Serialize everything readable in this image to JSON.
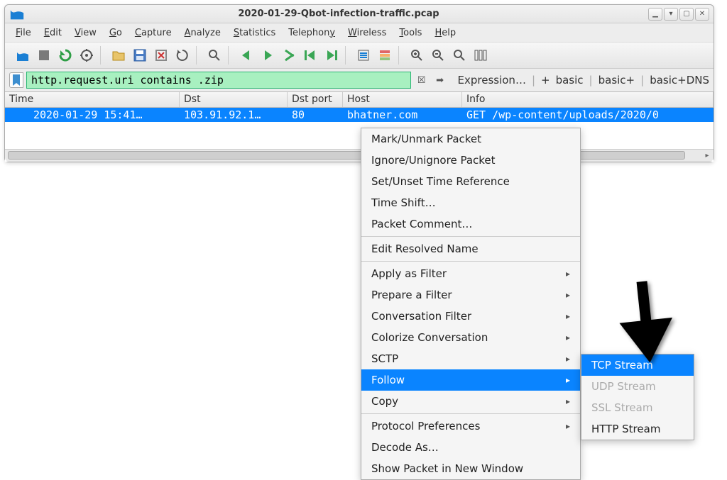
{
  "window": {
    "title": "2020-01-29-Qbot-infection-traffic.pcap"
  },
  "menubar": [
    "File",
    "Edit",
    "View",
    "Go",
    "Capture",
    "Analyze",
    "Statistics",
    "Telephony",
    "Wireless",
    "Tools",
    "Help"
  ],
  "filter": {
    "value": "http.request.uri contains .zip",
    "expression_label": "Expression…",
    "btn_plus": "+",
    "bookmarks": [
      "basic",
      "basic+",
      "basic+DNS"
    ]
  },
  "columns": {
    "time": "Time",
    "dst": "Dst",
    "dstport": "Dst port",
    "host": "Host",
    "info": "Info"
  },
  "rows": [
    {
      "time": "2020-01-29 15:41…",
      "dst": "103.91.92.1…",
      "dstport": "80",
      "host": "bhatner.com",
      "info": "GET /wp-content/uploads/2020/0"
    }
  ],
  "context_menu": {
    "items": [
      {
        "label": "Mark/Unmark Packet"
      },
      {
        "label": "Ignore/Unignore Packet"
      },
      {
        "label": "Set/Unset Time Reference"
      },
      {
        "label": "Time Shift…"
      },
      {
        "label": "Packet Comment…"
      },
      {
        "sep": true
      },
      {
        "label": "Edit Resolved Name"
      },
      {
        "sep": true
      },
      {
        "label": "Apply as Filter",
        "submenu": true
      },
      {
        "label": "Prepare a Filter",
        "submenu": true
      },
      {
        "label": "Conversation Filter",
        "submenu": true
      },
      {
        "label": "Colorize Conversation",
        "submenu": true
      },
      {
        "label": "SCTP",
        "submenu": true
      },
      {
        "label": "Follow",
        "submenu": true,
        "highlight": true
      },
      {
        "label": "Copy",
        "submenu": true
      },
      {
        "sep": true
      },
      {
        "label": "Protocol Preferences",
        "submenu": true
      },
      {
        "label": "Decode As…"
      },
      {
        "label": "Show Packet in New Window"
      }
    ]
  },
  "follow_submenu": [
    {
      "label": "TCP Stream",
      "highlight": true
    },
    {
      "label": "UDP Stream",
      "disabled": true
    },
    {
      "label": "SSL Stream",
      "disabled": true
    },
    {
      "label": "HTTP Stream"
    }
  ]
}
